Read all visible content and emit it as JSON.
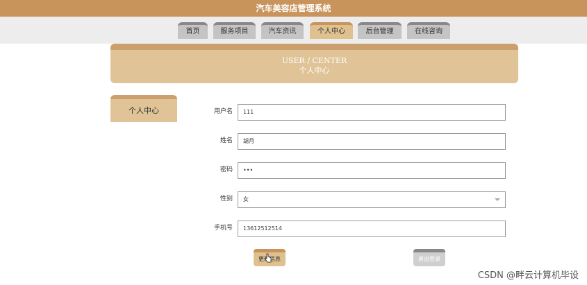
{
  "app": {
    "title": "汽车美容店管理系统"
  },
  "nav": {
    "items": [
      {
        "label": "首页",
        "active": false
      },
      {
        "label": "服务项目",
        "active": false
      },
      {
        "label": "汽车资讯",
        "active": false
      },
      {
        "label": "个人中心",
        "active": true
      },
      {
        "label": "后台管理",
        "active": false
      },
      {
        "label": "在线咨询",
        "active": false
      }
    ]
  },
  "banner": {
    "en": "USER / CENTER",
    "cn": "个人中心"
  },
  "sidebar": {
    "tab_label": "个人中心"
  },
  "form": {
    "username": {
      "label": "用户名",
      "value": "111"
    },
    "name": {
      "label": "姓名",
      "value": "胡月"
    },
    "password": {
      "label": "密码",
      "value": "•••"
    },
    "gender": {
      "label": "性别",
      "value": "女"
    },
    "phone": {
      "label": "手机号",
      "value": "13612512514"
    }
  },
  "buttons": {
    "update": "更新信息",
    "logout": "退出登录"
  },
  "watermark": "CSDN @畔云计算机毕设",
  "colors": {
    "brand": "#c8945c",
    "accent_light": "#e0c497",
    "nav_inactive": "#c4c4c4"
  }
}
